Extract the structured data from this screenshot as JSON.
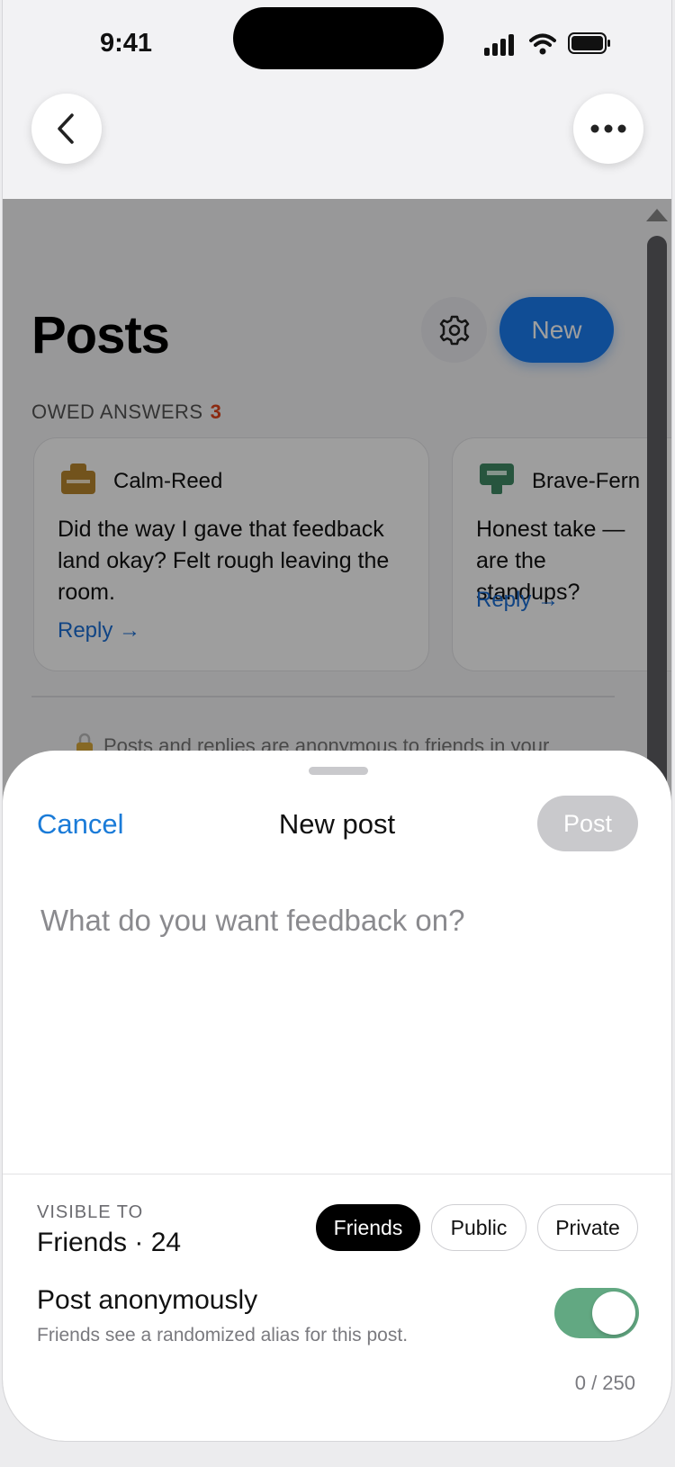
{
  "status_bar": {
    "time": "9:41"
  },
  "page": {
    "title": "Posts",
    "new_button": "New",
    "owed_label": "OWED ANSWERS",
    "owed_count": "3",
    "cards": [
      {
        "name": "Calm-Reed",
        "text": "Did the way I gave that feedback land okay? Felt rough leaving the room.",
        "reply": "Reply →",
        "avatar_color": "#b8862e"
      },
      {
        "name": "Brave-Fern",
        "text": "Honest take — are the standups?",
        "reply": "Reply →",
        "avatar_color": "#3f8a65"
      }
    ],
    "notice": "Posts and replies are anonymous to friends in your"
  },
  "sheet": {
    "cancel": "Cancel",
    "title": "New post",
    "post_button": "Post",
    "composer_placeholder": "What do you want feedback on?",
    "visible_to_label": "VISIBLE TO",
    "visible_to_value": "Friends · 24",
    "chips": [
      "Friends",
      "Public",
      "Private"
    ],
    "anon_title": "Post anonymously",
    "anon_subtitle": "Friends see a randomized alias for this post.",
    "counter": "0 / 250"
  },
  "colors": {
    "accent": "#1a7cf0",
    "owed": "#e0451c",
    "toggle_on": "#62a882"
  },
  "icons": [
    "back-chevron-icon",
    "more-dots-icon",
    "gear-icon",
    "lock-icon",
    "signal-icon",
    "wifi-icon",
    "battery-icon"
  ]
}
